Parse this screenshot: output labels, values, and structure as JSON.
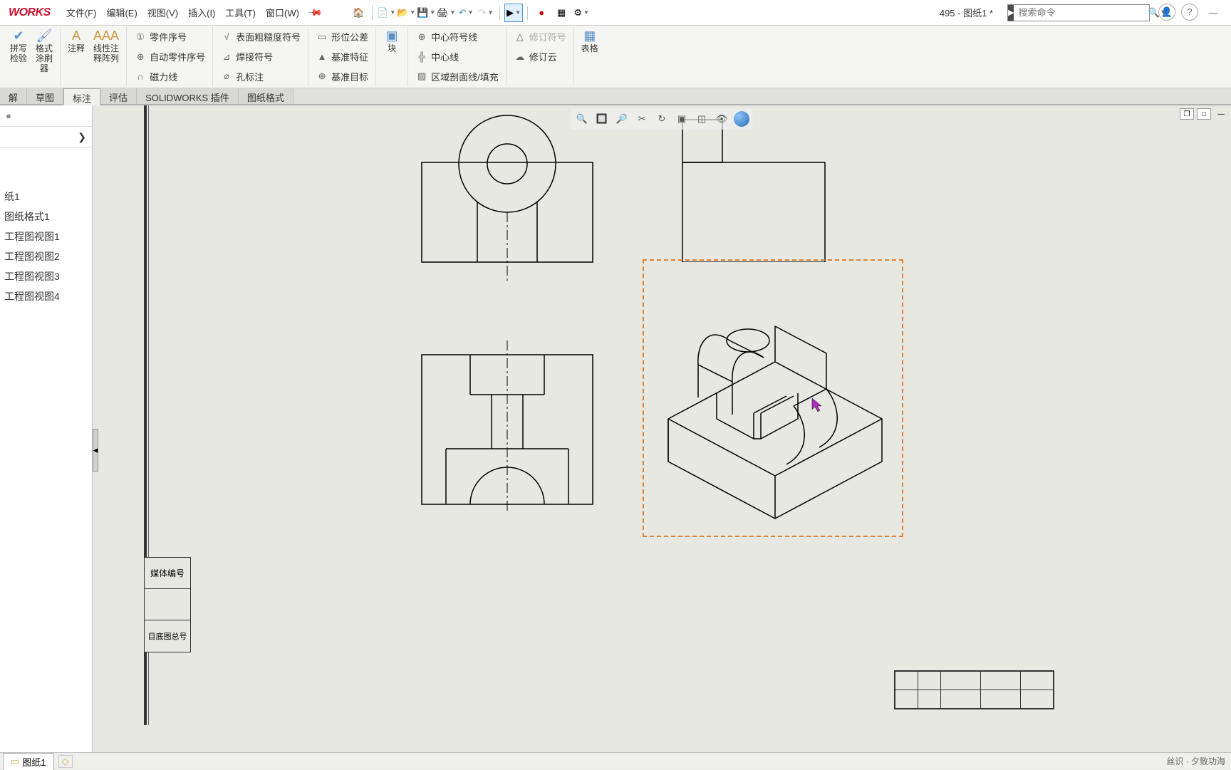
{
  "app": {
    "logo": "WORKS",
    "title": "495 - 图纸1 *"
  },
  "menu": {
    "file": "文件(F)",
    "edit": "编辑(E)",
    "view": "视图(V)",
    "insert": "插入(I)",
    "tools": "工具(T)",
    "window": "窗口(W)"
  },
  "search": {
    "placeholder": "搜索命令"
  },
  "ribbon": {
    "spell": "拼写\n检验",
    "format": "格式\n涂刷\n器",
    "note": "注释",
    "linear_pattern": "线性注\n释阵列",
    "part_seq": "零件序号",
    "auto_part_seq": "自动零件序号",
    "magnetic": "磁力线",
    "surface_rough": "表面粗糙度符号",
    "weld_symbol": "焊接符号",
    "hole_callout": "孔标注",
    "geo_tolerance": "形位公差",
    "datum_feature": "基准特征",
    "datum_target": "基准目标",
    "block": "块",
    "center_mark": "中心符号线",
    "centerline": "中心线",
    "area_hatch": "区域剖面线/填充",
    "revision_symbol": "修订符号",
    "revision_cloud": "修订云",
    "tables": "表格"
  },
  "tabs": {
    "solve": "解",
    "sketch": "草图",
    "annotation": "标注",
    "evaluate": "评估",
    "plugins": "SOLIDWORKS 插件",
    "sheet_format": "图纸格式"
  },
  "tree": {
    "sheet1": "纸1",
    "sheet_format1": "图纸格式1",
    "view1": "工程图视图1",
    "view2": "工程图视图2",
    "view3": "工程图视图3",
    "view4": "工程图视图4"
  },
  "title_block": {
    "media_num": "媒体编号",
    "base_drawing": "目底图总号"
  },
  "bottom": {
    "sheet_tab": "图纸1",
    "status": "丝识 · 夕致功海"
  }
}
